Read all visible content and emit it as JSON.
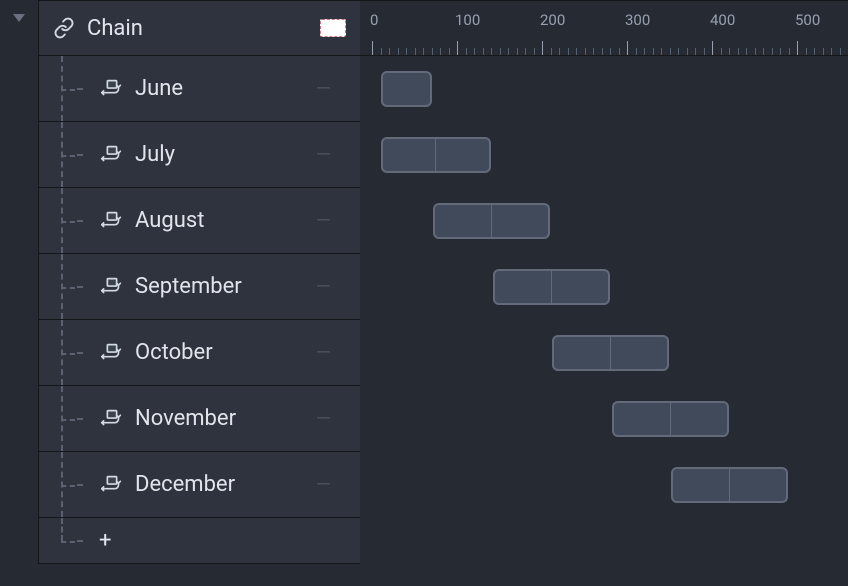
{
  "header": {
    "title": "Chain"
  },
  "ruler": {
    "ticks": [
      0,
      100,
      200,
      300,
      400,
      500
    ],
    "minor_step": 10,
    "pixels_per_unit": 0.85
  },
  "items": [
    {
      "label": "June",
      "bars": [
        {
          "start": 10,
          "end": 70
        }
      ]
    },
    {
      "label": "July",
      "bars": [
        {
          "start": 10,
          "end": 70
        },
        {
          "start": 70,
          "end": 140
        }
      ]
    },
    {
      "label": "August",
      "bars": [
        {
          "start": 72,
          "end": 140
        },
        {
          "start": 140,
          "end": 210
        }
      ]
    },
    {
      "label": "September",
      "bars": [
        {
          "start": 142,
          "end": 210
        },
        {
          "start": 210,
          "end": 280
        }
      ]
    },
    {
      "label": "October",
      "bars": [
        {
          "start": 212,
          "end": 280
        },
        {
          "start": 280,
          "end": 350
        }
      ]
    },
    {
      "label": "November",
      "bars": [
        {
          "start": 282,
          "end": 350
        },
        {
          "start": 350,
          "end": 420
        }
      ]
    },
    {
      "label": "December",
      "bars": [
        {
          "start": 352,
          "end": 420
        },
        {
          "start": 420,
          "end": 490
        }
      ]
    }
  ],
  "add_label": "+"
}
